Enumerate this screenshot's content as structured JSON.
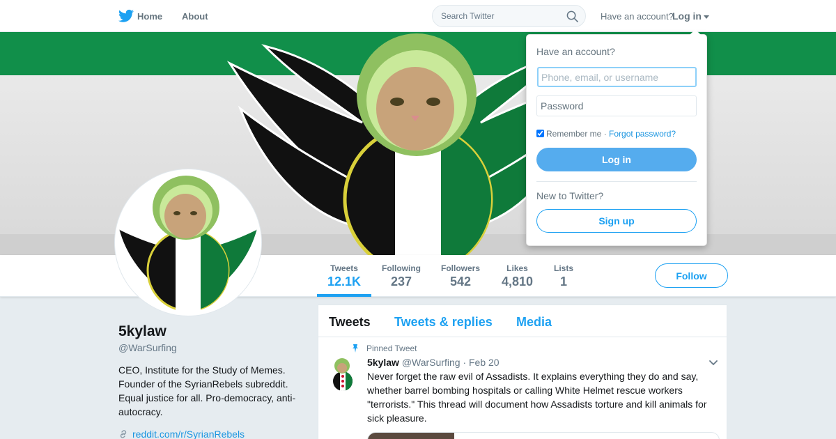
{
  "nav": {
    "home_label": "Home",
    "about_label": "About",
    "search_placeholder": "Search Twitter",
    "have_account": "Have an account?",
    "login_label": "Log in"
  },
  "profile": {
    "name": "5kylaw",
    "handle": "@WarSurfing",
    "bio": "CEO, Institute for the Study of Memes. Founder of the SyrianRebels subreddit. Equal justice for all. Pro-democracy, anti-autocracy.",
    "link": "reddit.com/r/SyrianRebels"
  },
  "stats": [
    {
      "label": "Tweets",
      "value": "12.1K",
      "active": true
    },
    {
      "label": "Following",
      "value": "237"
    },
    {
      "label": "Followers",
      "value": "542"
    },
    {
      "label": "Likes",
      "value": "4,810"
    },
    {
      "label": "Lists",
      "value": "1"
    }
  ],
  "follow_label": "Follow",
  "tabs": [
    "Tweets",
    "Tweets & replies",
    "Media"
  ],
  "pinned_tweet": {
    "pinned_label": "Pinned Tweet",
    "name": "5kylaw",
    "handle": "@WarSurfing",
    "separator": "·",
    "date": "Feb 20",
    "text": "Never forget the raw evil of Assadists. It explains everything they do and say, whether barrel bombing hospitals or calling White Helmet rescue workers \"terrorists.\" This thread will document how Assadists torture and kill animals for sick pleasure."
  },
  "login_dropdown": {
    "title": "Have an account?",
    "username_placeholder": "Phone, email, or username",
    "password_placeholder": "Password",
    "remember_label": "Remember me",
    "separator": "·",
    "forgot_label": "Forgot password?",
    "login_button": "Log in",
    "new_label": "New to Twitter?",
    "signup_button": "Sign up"
  },
  "colors": {
    "accent": "#1da1f2",
    "login_button": "#55acee",
    "flag_green": "#007a3d",
    "flag_red": "#ce1126"
  }
}
